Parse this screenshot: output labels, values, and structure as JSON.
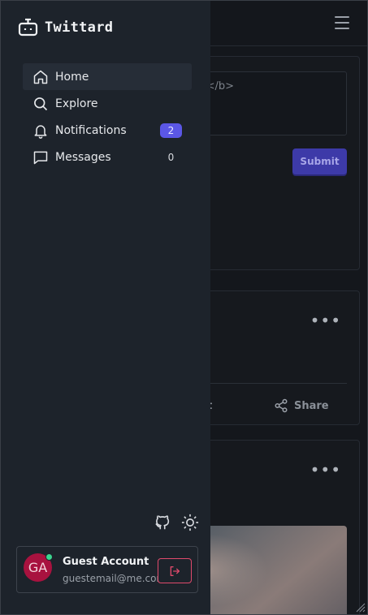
{
  "app": {
    "name": "Twittard"
  },
  "composer": {
    "text_fragment": "</b>",
    "submit_label": "Submit"
  },
  "posts": [
    {
      "action_fragment": "t",
      "share_label": "Share"
    },
    {}
  ],
  "nav": {
    "items": [
      {
        "label": "Home",
        "icon": "home-icon",
        "active": true
      },
      {
        "label": "Explore",
        "icon": "search-icon"
      },
      {
        "label": "Notifications",
        "icon": "bell-icon",
        "badge": "2"
      },
      {
        "label": "Messages",
        "icon": "chat-icon",
        "badge": "0"
      }
    ]
  },
  "account": {
    "initials": "GA",
    "name": "Guest Account",
    "email": "guestemail@me.com"
  },
  "colors": {
    "accent": "#5b57e6",
    "avatar": "#a8123f",
    "logout": "#e04a6c",
    "online": "#3bd58f"
  }
}
